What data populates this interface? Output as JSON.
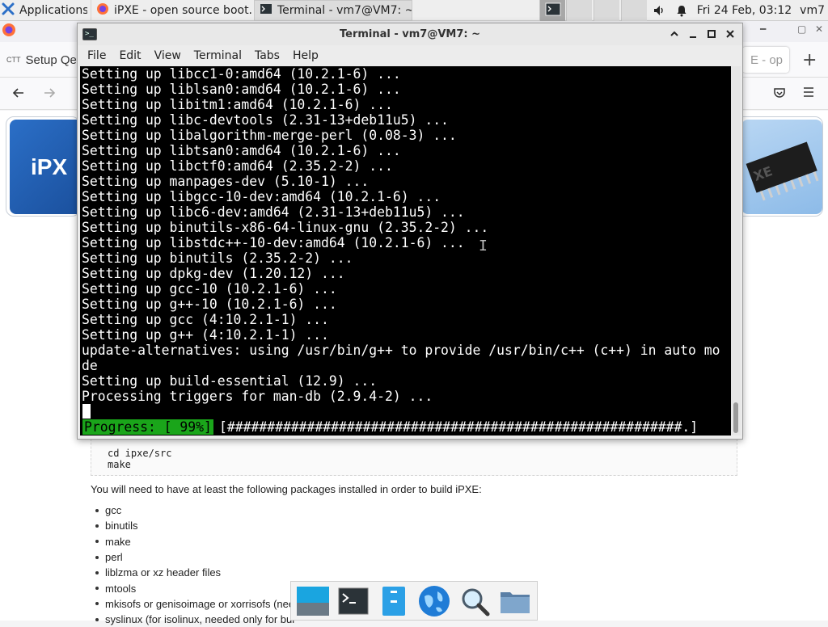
{
  "panel": {
    "apps_menu_label": "Applications",
    "task_firefox_label": "iPXE - open source boot...",
    "task_terminal_label": "Terminal - vm7@VM7: ~",
    "clock": "Fri 24 Feb, 03:12",
    "user": "vm7"
  },
  "firefox": {
    "tab_left_label": "Setup Qe",
    "tab_left_icon_text": "CTT",
    "tab_right_label": "E - op",
    "new_tab": "+"
  },
  "terminal": {
    "title": "Terminal - vm7@VM7: ~",
    "menu": [
      "File",
      "Edit",
      "View",
      "Terminal",
      "Tabs",
      "Help"
    ],
    "lines": [
      "Setting up libcc1-0:amd64 (10.2.1-6) ...",
      "Setting up liblsan0:amd64 (10.2.1-6) ...",
      "Setting up libitm1:amd64 (10.2.1-6) ...",
      "Setting up libc-devtools (2.31-13+deb11u5) ...",
      "Setting up libalgorithm-merge-perl (0.08-3) ...",
      "Setting up libtsan0:amd64 (10.2.1-6) ...",
      "Setting up libctf0:amd64 (2.35.2-2) ...",
      "Setting up manpages-dev (5.10-1) ...",
      "Setting up libgcc-10-dev:amd64 (10.2.1-6) ...",
      "Setting up libc6-dev:amd64 (2.31-13+deb11u5) ...",
      "Setting up binutils-x86-64-linux-gnu (2.35.2-2) ...",
      "Setting up libstdc++-10-dev:amd64 (10.2.1-6) ...",
      "Setting up binutils (2.35.2-2) ...",
      "Setting up dpkg-dev (1.20.12) ...",
      "Setting up gcc-10 (10.2.1-6) ...",
      "Setting up g++-10 (10.2.1-6) ...",
      "Setting up gcc (4:10.2.1-1) ...",
      "Setting up g++ (4:10.2.1-1) ...",
      "update-alternatives: using /usr/bin/g++ to provide /usr/bin/c++ (c++) in auto mo",
      "de",
      "Setting up build-essential (12.9) ...",
      "Processing triggers for man-db (2.9.4-2) ..."
    ],
    "progress_label": "Progress: [ 99%]",
    "progress_bar": "[#########################################################.]",
    "progress_value": 0.99
  },
  "page": {
    "code_lines": [
      "cd ipxe/src",
      "make"
    ],
    "packages_intro": "You will need to have at least the following packages installed in order to build iPXE:",
    "packages": [
      "gcc",
      "binutils",
      "make",
      "perl",
      "liblzma or xz header files",
      "mtools",
      "mkisofs or genisoimage or xorrisofs (nee",
      "syslinux (for isolinux, needed only for bui"
    ],
    "logo_text": "iPX"
  },
  "chart_data": {
    "type": "table",
    "title": "",
    "rows": [
      [
        "libcc1-0:amd64",
        "10.2.1-6"
      ],
      [
        "liblsan0:amd64",
        "10.2.1-6"
      ],
      [
        "libitm1:amd64",
        "10.2.1-6"
      ],
      [
        "libc-devtools",
        "2.31-13+deb11u5"
      ],
      [
        "libalgorithm-merge-perl",
        "0.08-3"
      ],
      [
        "libtsan0:amd64",
        "10.2.1-6"
      ],
      [
        "libctf0:amd64",
        "2.35.2-2"
      ],
      [
        "manpages-dev",
        "5.10-1"
      ],
      [
        "libgcc-10-dev:amd64",
        "10.2.1-6"
      ],
      [
        "libc6-dev:amd64",
        "2.31-13+deb11u5"
      ],
      [
        "binutils-x86-64-linux-gnu",
        "2.35.2-2"
      ],
      [
        "libstdc++-10-dev:amd64",
        "10.2.1-6"
      ],
      [
        "binutils",
        "2.35.2-2"
      ],
      [
        "dpkg-dev",
        "1.20.12"
      ],
      [
        "gcc-10",
        "10.2.1-6"
      ],
      [
        "g++-10",
        "10.2.1-6"
      ],
      [
        "gcc",
        "4:10.2.1-1"
      ],
      [
        "g++",
        "4:10.2.1-1"
      ],
      [
        "build-essential",
        "12.9"
      ],
      [
        "man-db",
        "2.9.4-2"
      ]
    ]
  }
}
